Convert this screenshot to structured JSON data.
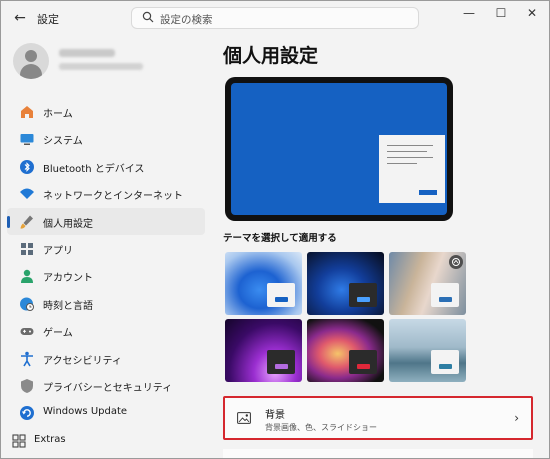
{
  "titlebar": {
    "back_glyph": "←",
    "title": "設定",
    "search_placeholder": "設定の検索",
    "minimize_glyph": "—",
    "maximize_glyph": "☐",
    "close_glyph": "✕"
  },
  "nav": {
    "items": [
      {
        "label": "ホーム",
        "icon": "home-icon"
      },
      {
        "label": "システム",
        "icon": "display-icon"
      },
      {
        "label": "Bluetooth とデバイス",
        "icon": "bluetooth-icon"
      },
      {
        "label": "ネットワークとインターネット",
        "icon": "wifi-icon"
      },
      {
        "label": "個人用設定",
        "icon": "brush-icon",
        "selected": true
      },
      {
        "label": "アプリ",
        "icon": "apps-icon"
      },
      {
        "label": "アカウント",
        "icon": "person-icon"
      },
      {
        "label": "時刻と言語",
        "icon": "globe-clock-icon"
      },
      {
        "label": "ゲーム",
        "icon": "controller-icon"
      },
      {
        "label": "アクセシビリティ",
        "icon": "accessibility-icon"
      },
      {
        "label": "プライバシーとセキュリティ",
        "icon": "shield-icon"
      },
      {
        "label": "Windows Update",
        "icon": "update-icon"
      },
      {
        "label": "Extras",
        "icon": "extras-icon"
      }
    ]
  },
  "main": {
    "page_title": "個人用設定",
    "themes_label": "テーマを選択して適用する",
    "background": {
      "title": "背景",
      "subtitle": "背景画像、色、スライドショー",
      "chevron": "›"
    }
  },
  "colors": {
    "accent": "#1561c2",
    "highlight_border": "#d5272e"
  }
}
